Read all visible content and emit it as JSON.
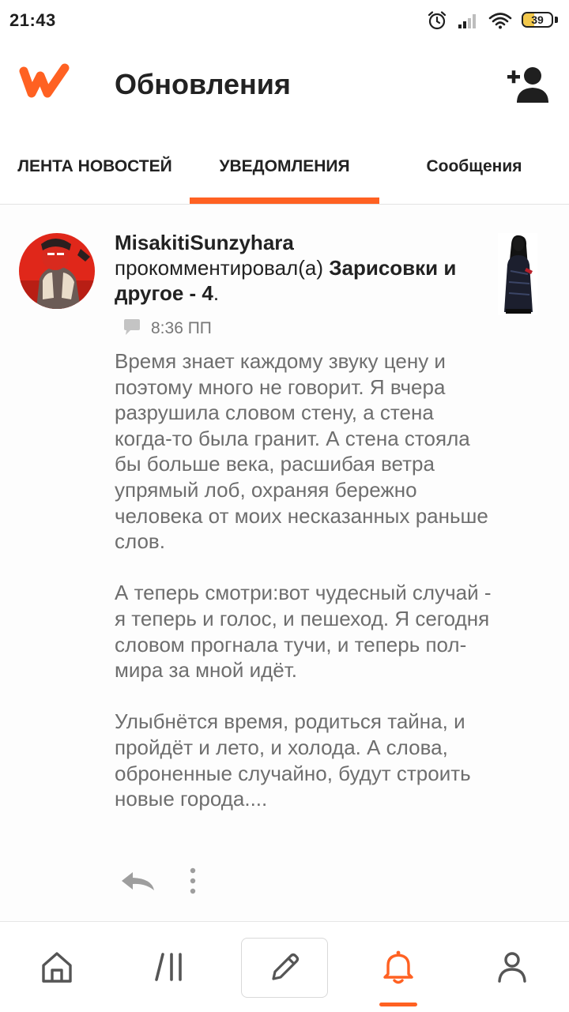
{
  "status_bar": {
    "time": "21:43",
    "battery": "39",
    "battery_level_percent": 39,
    "icons": [
      "alarm-icon",
      "signal-icon",
      "wifi-icon",
      "battery-icon"
    ]
  },
  "header": {
    "title": "Обновления",
    "logo_icon": "wattpad-logo",
    "action_icon": "add-user-icon",
    "brand_color": "#ff6122"
  },
  "tabs": [
    {
      "label": "ЛЕНТА НОВОСТЕЙ",
      "active": false
    },
    {
      "label": "УВЕДОМЛЕНИЯ",
      "active": true
    },
    {
      "label": "Сообщения",
      "active": false
    }
  ],
  "notification": {
    "username": "MisakitiSunzyhara",
    "action": "прокомментировал(а)",
    "story": "Зарисовки и другое - 4",
    "suffix": ".",
    "time": "8:36 ПП",
    "comment_paragraphs": [
      "Время знает каждому звуку цену и поэтому много не говорит. Я вчера разрушила словом стену, а стена когда-то была гранит. А стена стояла бы больше века, расшибая ветра упрямый лоб, охраняя бережно человека от моих несказанных раньше слов.",
      "А теперь смотри:вот чудесный случай - я теперь и голос, и пешеход. Я сегодня словом прогнала тучи, и теперь пол-мира за мной идёт.",
      "Улыбнётся время, родиться тайна, и пройдёт и лето, и холода. А слова, оброненные случайно, будут строить новые города...."
    ]
  },
  "bottom_nav": [
    {
      "icon": "home-icon",
      "active": false
    },
    {
      "icon": "library-icon",
      "active": false
    },
    {
      "icon": "pencil-icon",
      "active": false
    },
    {
      "icon": "bell-icon",
      "active": true
    },
    {
      "icon": "profile-icon",
      "active": false
    }
  ]
}
